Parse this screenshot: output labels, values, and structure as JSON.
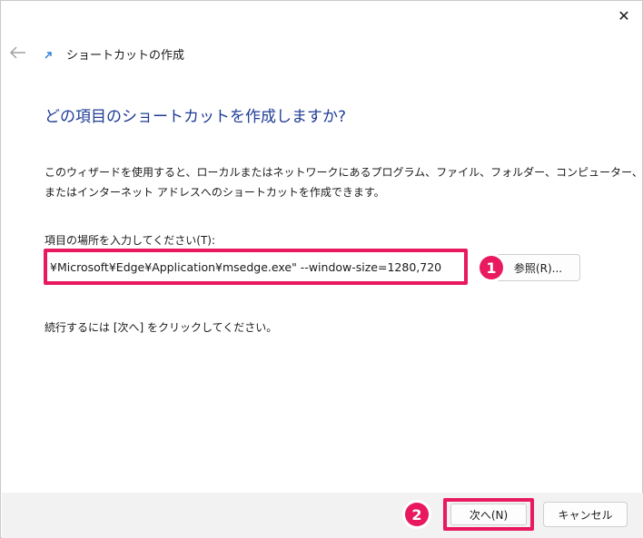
{
  "window": {
    "title": "ショートカットの作成",
    "close_glyph": "✕",
    "back_glyph": "←"
  },
  "main": {
    "heading": "どの項目のショートカットを作成しますか?",
    "description_line1": "このウィザードを使用すると、ローカルまたはネットワークにあるプログラム、ファイル、フォルダー、コンピューター、",
    "description_line2": "またはインターネット アドレスへのショートカットを作成できます。",
    "location_label": "項目の場所を入力してください(T):",
    "location_value": "¥Microsoft¥Edge¥Application¥msedge.exe\" --window-size=1280,720",
    "browse_label": "参照(R)...",
    "hint": "続行するには [次へ] をクリックしてください。"
  },
  "footer": {
    "next_label": "次へ(N)",
    "cancel_label": "キャンセル"
  },
  "annotations": {
    "badge1": "1",
    "badge2": "2"
  },
  "colors": {
    "accent": "#e8195f",
    "heading": "#1e3c96",
    "footer_bg": "#f2f2f2"
  },
  "icons": {
    "close": "close-icon",
    "back": "back-arrow-icon",
    "shortcut": "shortcut-arrow-icon"
  }
}
